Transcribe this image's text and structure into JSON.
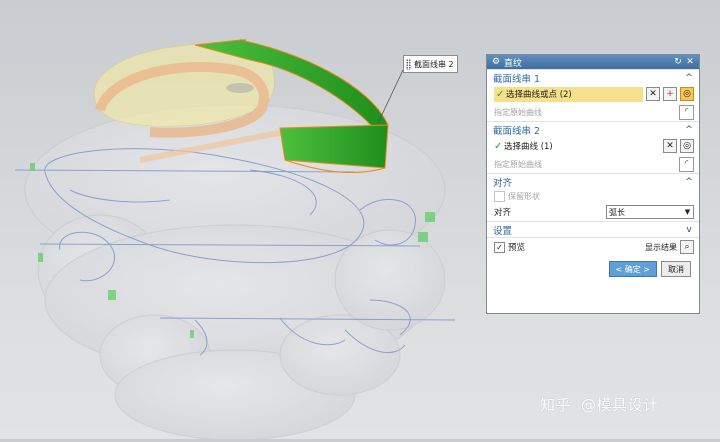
{
  "callout": {
    "label": "截面线串 2"
  },
  "dialog": {
    "title": "直纹",
    "section1": {
      "header": "截面线串 1",
      "select_label": "选择曲线或点 (2)",
      "origin_label": "指定原始曲线"
    },
    "section2": {
      "header": "截面线串 2",
      "select_label": "选择曲线 (1)",
      "origin_label": "指定原始曲线"
    },
    "align": {
      "header": "对齐",
      "keep_shape_label": "保留形状",
      "align_label": "对齐",
      "align_value": "弧长"
    },
    "settings": {
      "header": "设置"
    },
    "preview_label": "预览",
    "show_result_label": "显示结果",
    "ok_label": "< 确定 >",
    "cancel_label": "取消"
  },
  "watermark": {
    "brand": "知乎",
    "author": "@模具设计"
  },
  "icons": {
    "title": "gear-icon",
    "reset": "reset-icon",
    "close": "close-icon",
    "collapse": "chevron-up-icon",
    "expand": "chevron-down-icon",
    "check": "check-icon",
    "clear": "clear-selection-icon",
    "add": "add-icon",
    "curve_select": "curve-select-icon",
    "origin": "origin-curve-icon",
    "show_result": "magnifier-icon"
  },
  "colors": {
    "accent": "#2e6aa6",
    "titlebar": "#4a7aab",
    "selected_row": "#f7e08a",
    "check": "#2d9a37",
    "surface_green": "#2ea62a",
    "ok_button": "#5f9fd6"
  }
}
